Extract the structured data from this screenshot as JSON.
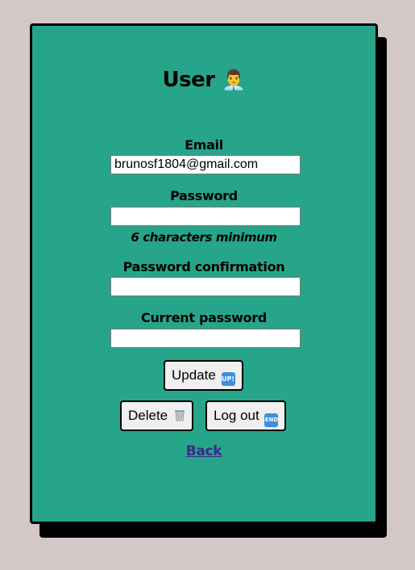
{
  "header": {
    "title": "User",
    "title_emoji": "👨‍💼"
  },
  "form": {
    "email_label": "Email",
    "email_value": "brunosf1804@gmail.com",
    "password_label": "Password",
    "password_value": "",
    "password_hint": "6 characters minimum",
    "password_confirmation_label": "Password confirmation",
    "password_confirmation_value": "",
    "current_password_label": "Current password",
    "current_password_value": ""
  },
  "actions": {
    "update_label": "Update",
    "update_icon": "up-button-icon",
    "delete_label": "Delete",
    "delete_icon": "wastebasket-icon",
    "logout_label": "Log out",
    "logout_icon": "end-arrow-icon",
    "back_label": "Back"
  },
  "colors": {
    "page_background": "#d4c8c6",
    "card_background": "#27a58a",
    "card_shadow": "#000000",
    "link": "#3a2a8a"
  }
}
